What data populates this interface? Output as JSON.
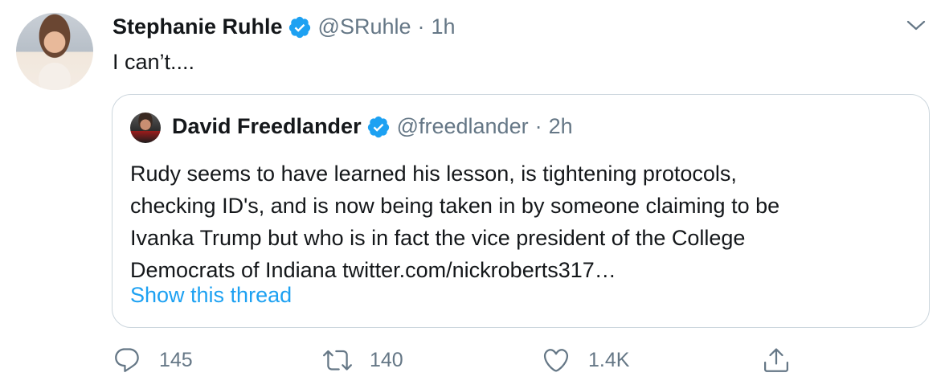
{
  "tweet": {
    "author_name": "Stephanie Ruhle",
    "author_handle": "@SRuhle",
    "separator": "·",
    "time": "1h",
    "text": "I can’t...."
  },
  "quoted": {
    "author_name": "David Freedlander",
    "author_handle": "@freedlander",
    "separator": "·",
    "time": "2h",
    "text_lines": [
      "Rudy seems to have learned his lesson, is tightening protocols,",
      "checking ID's, and is now being taken in by someone claiming to be",
      "Ivanka Trump but who is in fact the vice president of the College",
      "Democrats of Indiana twitter.com/nickroberts317…"
    ],
    "show_thread_label": "Show this thread"
  },
  "actions": {
    "replies": "145",
    "retweets": "140",
    "likes": "1.4K"
  },
  "colors": {
    "verified": "#1da1f2",
    "link": "#1da1f2",
    "secondary_text": "#657786",
    "border": "#ccd6dd"
  },
  "icons": [
    "verified-badge-icon",
    "chevron-down-icon",
    "reply-icon",
    "retweet-icon",
    "like-icon",
    "share-icon"
  ]
}
